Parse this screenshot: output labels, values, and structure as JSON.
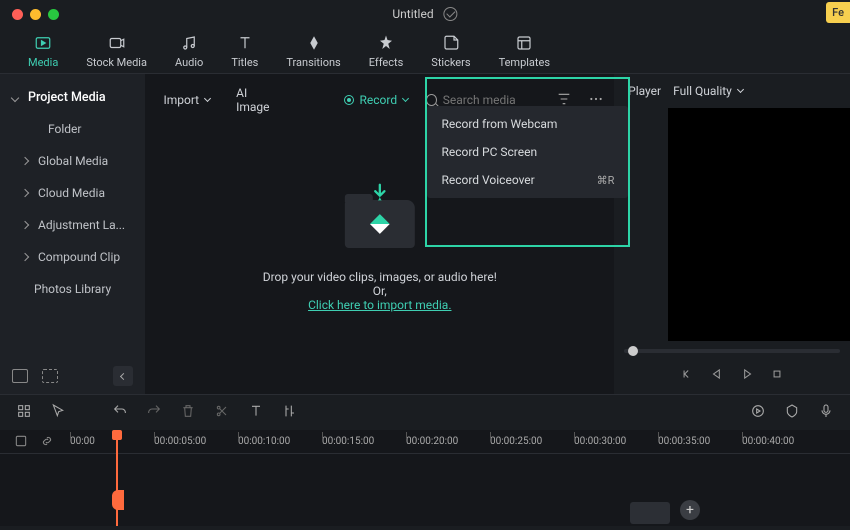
{
  "titlebar": {
    "title": "Untitled",
    "feedback": "Fe"
  },
  "mainTabs": [
    {
      "label": "Media",
      "active": true
    },
    {
      "label": "Stock Media"
    },
    {
      "label": "Audio"
    },
    {
      "label": "Titles"
    },
    {
      "label": "Transitions"
    },
    {
      "label": "Effects"
    },
    {
      "label": "Stickers"
    },
    {
      "label": "Templates"
    }
  ],
  "sidebar": {
    "head": "Project Media",
    "folder": "Folder",
    "items": [
      "Global Media",
      "Cloud Media",
      "Adjustment La...",
      "Compound Clip",
      "Photos Library"
    ]
  },
  "toolbar": {
    "import": "Import",
    "aiimage": "AI Image",
    "record": "Record",
    "searchPlaceholder": "Search media"
  },
  "recordMenu": {
    "webcam": "Record from Webcam",
    "screen": "Record PC Screen",
    "voice": "Record Voiceover",
    "voiceShortcut": "⌘R"
  },
  "drop": {
    "text": "Drop your video clips, images, or audio here! Or,",
    "link": "Click here to import media."
  },
  "player": {
    "label": "Player",
    "quality": "Full Quality"
  },
  "timeline": {
    "ticks": [
      "00:00",
      "00:00:05:00",
      "00:00:10:00",
      "00:00:15:00",
      "00:00:20:00",
      "00:00:25:00",
      "00:00:30:00",
      "00:00:35:00",
      "00:00:40:00"
    ]
  }
}
